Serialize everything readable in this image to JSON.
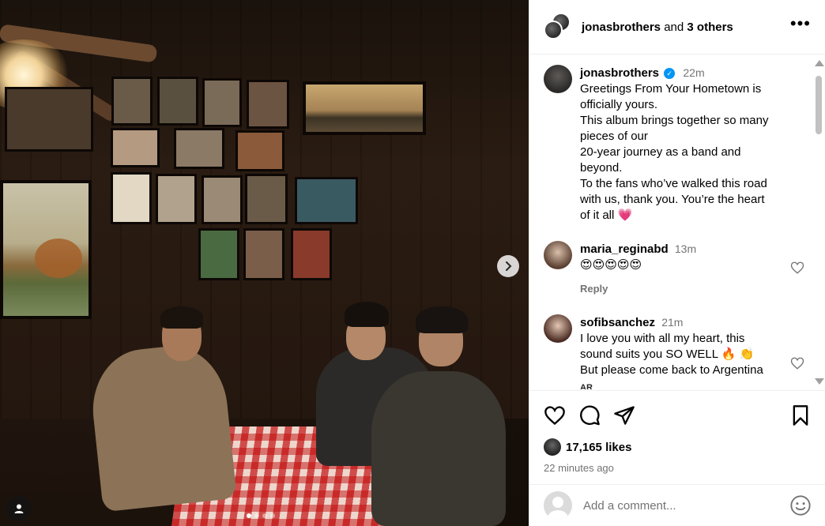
{
  "post_header": {
    "author": "jonasbrothers",
    "connector": "and",
    "others": "3 others",
    "more_icon": "more-horizontal-icon"
  },
  "photo": {
    "slides_total": 4,
    "active_slide": 1,
    "next_icon": "chevron-right-icon",
    "user_tag_icon": "user-icon"
  },
  "caption": {
    "username": "jonasbrothers",
    "verified": true,
    "time": "22m",
    "text": "Greetings From Your Hometown is officially yours.\nThis album brings together so many pieces of our\n20-year journey as a band and beyond.\nTo the fans who’ve walked this road with us, thank you. You’re the heart of it all 💗"
  },
  "comments": [
    {
      "username": "maria_reginabd",
      "time": "13m",
      "text": "😍😍😍😍😍",
      "reply_label": "Reply"
    },
    {
      "username": "sofibsanchez",
      "time": "21m",
      "text": "I love you with all my heart, this sound suits you SO WELL 🔥 👏\nBut please come back to Argentina",
      "extra": "AR"
    }
  ],
  "actions": {
    "like_icon": "heart-icon",
    "comment_icon": "comment-icon",
    "share_icon": "share-icon",
    "save_icon": "bookmark-icon",
    "likes_count": "17,165",
    "likes_suffix": "likes",
    "posted_ago": "22 minutes ago"
  },
  "add_comment": {
    "placeholder": "Add a comment...",
    "emoji_icon": "emoji-icon"
  },
  "colors": {
    "verified": "#0095f6",
    "muted_text": "#737373",
    "divider": "#efefef"
  }
}
